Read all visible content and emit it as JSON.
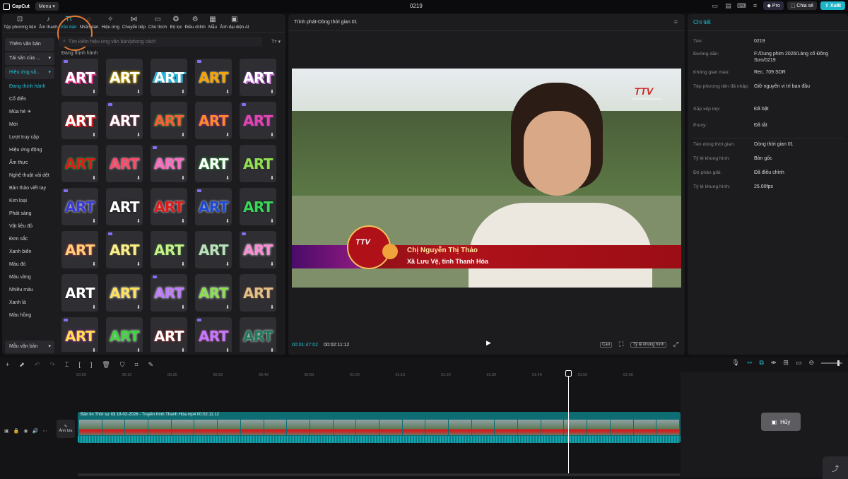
{
  "topbar": {
    "logo": "CapCut",
    "menu": "Menu",
    "title": "0219",
    "pro": "Pro",
    "share": "Chia sẻ",
    "export": "Xuất"
  },
  "tools": [
    "Tệp phương tiện",
    "Âm thanh",
    "Văn bản",
    "Nhãn dán",
    "Hiệu ứng",
    "Chuyển tiếp",
    "Chú thích",
    "Bộ lọc",
    "Điều chỉnh",
    "Mẫu",
    "Ảnh đại diện AI"
  ],
  "sidebar": {
    "add_text": "Thêm văn bản",
    "assets": "Tài sản của ...",
    "effects": "Hiệu ứng vă...",
    "items": [
      "Đang thịnh hành",
      "Cổ điển",
      "Mùa hè ☀",
      "Mới",
      "Lượt truy cập",
      "Hiệu ứng động",
      "Ẩm thực",
      "Nghệ thuật vải dệt",
      "Bản thảo viết tay",
      "Kim loại",
      "Phát sáng",
      "Vật liệu đó",
      "Đơn sắc",
      "Xanh biển",
      "Màu đỏ",
      "Màu vàng",
      "Nhiều màu",
      "Xanh lá",
      "Màu hồng"
    ],
    "templates": "Mẫu văn bản"
  },
  "content": {
    "search_placeholder": "Tìm kiếm hiệu ứng văn bản/phong cách",
    "section": "Đang thịnh hành",
    "tile_text": "ART"
  },
  "player": {
    "title": "Trình phát-Dòng thời gian 01",
    "caption_name": "Chị Nguyễn Thị Thảo",
    "caption_place": "Xã Lưu Vệ, tỉnh Thanh Hóa",
    "logo": "TTV",
    "logo_sub": "Truyenhinhthanhhoa.vn",
    "badge": "TTV",
    "time_current": "00:01:47:02",
    "time_total": "00:02:11:12",
    "quality": "Cao",
    "ratio": "Tỷ lệ khung hình"
  },
  "details": {
    "header": "Chi tiết",
    "rows": [
      {
        "label": "Tên:",
        "value": "0219"
      },
      {
        "label": "Đường dẫn:",
        "value": "F:/Dung phim 2026/Làng cổ Đông Sơn/0219"
      },
      {
        "label": "Không gian màu:",
        "value": "Rec. 709 SDR"
      },
      {
        "label": "Tệp phương tiện đã nhập:",
        "value": "Giữ nguyên vị trí ban đầu"
      },
      {
        "label": "Sắp xếp lớp:",
        "value": "Đã bật"
      },
      {
        "label": "Proxy:",
        "value": "Đã tắt"
      },
      {
        "label": "Tên dòng thời gian:",
        "value": "Dòng thời gian 01"
      },
      {
        "label": "Tỷ lệ khung hình:",
        "value": "Bản gốc"
      },
      {
        "label": "Độ phân giải:",
        "value": "Đã điều chỉnh"
      },
      {
        "label": "Tỷ lệ khung hình:",
        "value": "25.00fps"
      }
    ]
  },
  "timeline": {
    "clip_label": "Bản tin Thời sự tối 18-02-2026 - Truyền hình Thanh Hóa.mp4   00:02:11:12",
    "cover": "Ảnh bìa",
    "cancel": "Hủy",
    "ticks": [
      "00:00",
      "00:10",
      "00:20",
      "00:30",
      "00:40",
      "00:50",
      "01:00",
      "01:10",
      "01:20",
      "01:30",
      "01:40",
      "01:50",
      "02:00"
    ]
  }
}
